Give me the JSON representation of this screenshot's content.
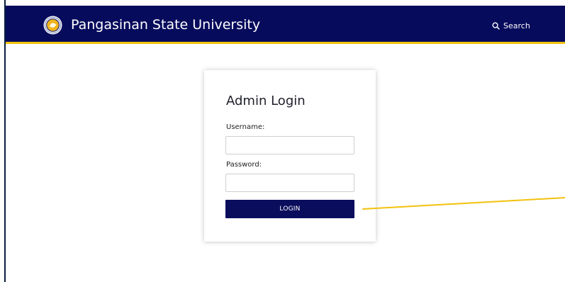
{
  "header": {
    "title": "Pangasinan State University",
    "search_label": "Search",
    "logo_icon": "university-seal-icon",
    "search_icon": "search-icon",
    "colors": {
      "bar": "#070b5c",
      "accent": "#f2c10e"
    }
  },
  "login": {
    "title": "Admin Login",
    "username_label": "Username:",
    "username_value": "",
    "password_label": "Password:",
    "password_value": "",
    "button_label": "LOGIN",
    "colors": {
      "button": "#0a0d5c"
    }
  },
  "annotation": {
    "color": "#f2c10e"
  }
}
